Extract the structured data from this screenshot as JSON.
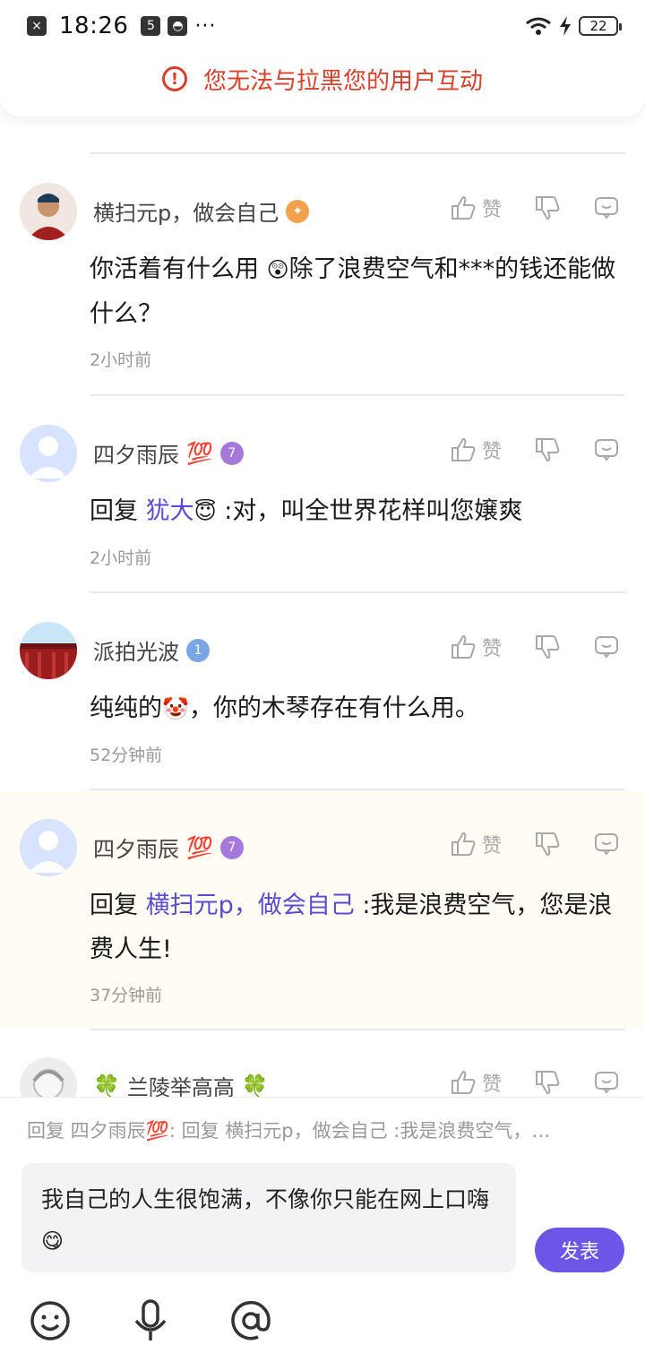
{
  "status_bar": {
    "time": "18:26",
    "battery": "22",
    "dots": "···"
  },
  "warning": {
    "text": "您无法与拉黑您的用户互动"
  },
  "comments": [
    {
      "author": "横扫元p，做会自己",
      "text_before": "你活着有什么用",
      "emoji": "😲",
      "text_after": "除了浪费空气和***的钱还能做什么？",
      "time": "2小时前",
      "like_label": "赞"
    },
    {
      "author": "四夕雨辰",
      "author_emoji": "💯",
      "reply_prefix": "回复",
      "mention": "犹大",
      "mention_emoji": "😇",
      "text_after": ":对，叫全世界花样叫您嬢爽",
      "time": "2小时前",
      "like_label": "赞"
    },
    {
      "author": "派拍光波",
      "text_before": "纯纯的",
      "emoji": "🤡",
      "text_after": "，你的木琴存在有什么用。",
      "time": "52分钟前",
      "like_label": "赞"
    },
    {
      "author": "四夕雨辰",
      "author_emoji": "💯",
      "reply_prefix": "回复",
      "mention": "横扫元p，做会自己",
      "text_after": ":我是浪费空气，您是浪费人生!",
      "time": "37分钟前",
      "like_label": "赞"
    },
    {
      "author": "兰陵举高高",
      "author_emoji_left": "🍀",
      "author_emoji_right": "🍀",
      "like_label": "赞"
    }
  ],
  "reply_hint": "回复 四夕雨辰💯: 回复 横扫元p，做会自己 :我是浪费空气，…",
  "input": {
    "value": "我自己的人生很饱满，不像你只能在网上口嗨",
    "emoji": "😋"
  },
  "publish_label": "发表",
  "colors": {
    "accent": "#6d55e8",
    "warning": "#d9402c",
    "mention": "#5b4bcf",
    "highlight_bg": "#fffdf3"
  }
}
